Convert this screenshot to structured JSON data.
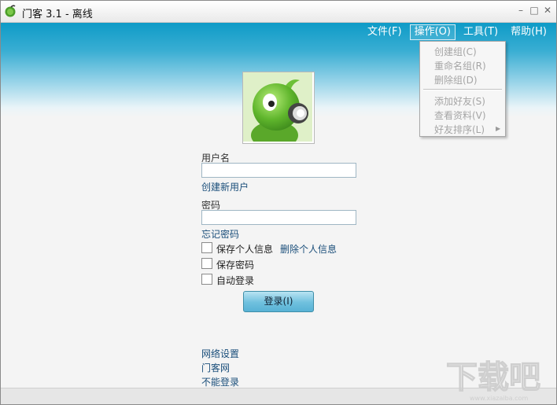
{
  "window": {
    "title": "门客 3.1 - 离线"
  },
  "window_controls": {
    "minimize": "–",
    "maximize": "□",
    "close": "✕"
  },
  "menu": [
    {
      "label": "文件(F)"
    },
    {
      "label": "操作(O)",
      "active": true
    },
    {
      "label": "工具(T)"
    },
    {
      "label": "帮助(H)"
    }
  ],
  "dropdown": {
    "items": [
      {
        "label": "创建组(C)"
      },
      {
        "label": "重命名组(R)"
      },
      {
        "label": "删除组(D)"
      },
      {
        "label": "添加好友(S)"
      },
      {
        "label": "查看资料(V)"
      },
      {
        "label": "好友排序(L)"
      }
    ],
    "submenu_arrow": "▶"
  },
  "login": {
    "username_label": "用户名",
    "username_value": "",
    "create_user_link": "创建新用户",
    "password_label": "密码",
    "password_value": "",
    "forgot_password_link": "忘记密码",
    "save_info_label": "保存个人信息",
    "delete_info_link": "删除个人信息",
    "save_password_label": "保存密码",
    "auto_login_label": "自动登录",
    "login_button": "登录(I)"
  },
  "footer_links": {
    "network_settings": "网络设置",
    "site": "门客网",
    "cannot_login": "不能登录"
  },
  "watermark": {
    "text": "下载吧",
    "url": "www.xiazaiba.com"
  }
}
